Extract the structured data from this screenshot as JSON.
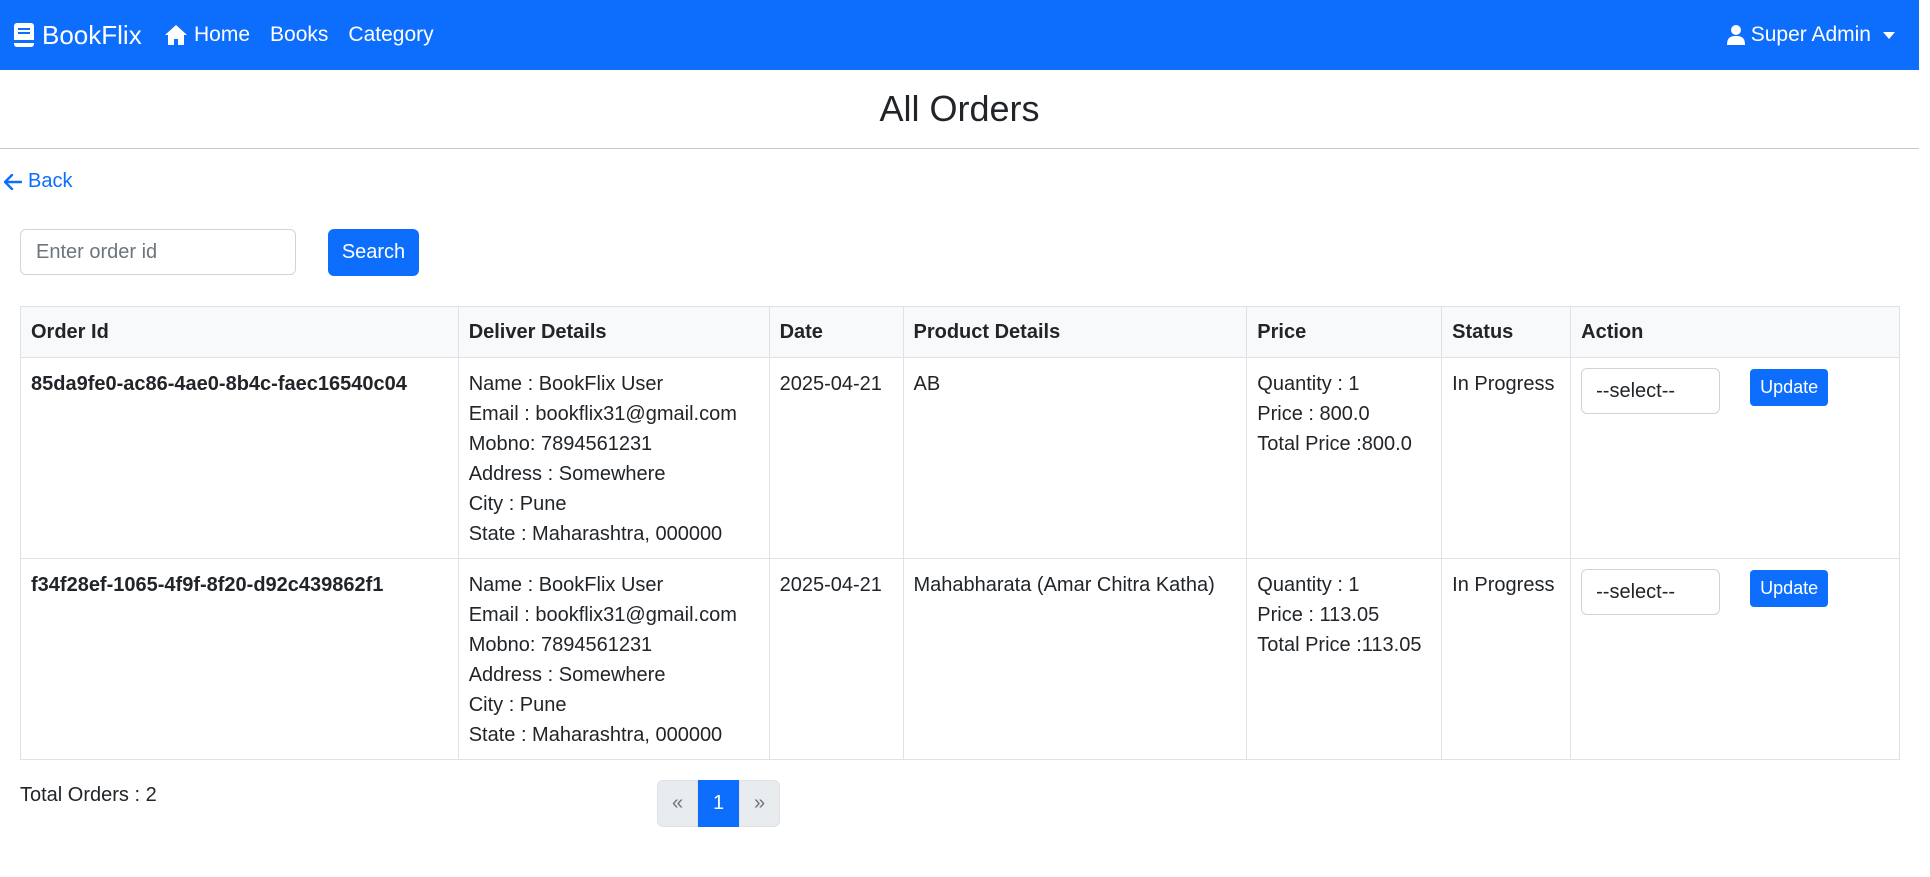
{
  "navbar": {
    "brand": "BookFlix",
    "links": [
      {
        "label": "Home",
        "icon": "home-icon"
      },
      {
        "label": "Books"
      },
      {
        "label": "Category"
      }
    ],
    "user_label": "Super Admin",
    "background": "#0d6efd"
  },
  "page": {
    "title": "All Orders",
    "back_label": "Back"
  },
  "search": {
    "placeholder": "Enter order id",
    "value": "",
    "button_label": "Search"
  },
  "table": {
    "headers": [
      "Order Id",
      "Deliver Details",
      "Date",
      "Product Details",
      "Price",
      "Status",
      "Action"
    ],
    "rows": [
      {
        "order_id": "85da9fe0-ac86-4ae0-8b4c-faec16540c04",
        "deliver": {
          "name": "Name : BookFlix User",
          "email": "Email : bookflix31@gmail.com",
          "mobno": "Mobno: 7894561231",
          "address": "Address : Somewhere",
          "city": "City : Pune",
          "state": "State : Maharashtra, 000000"
        },
        "date": "2025-04-21",
        "product": "AB",
        "price": {
          "quantity": "Quantity : 1",
          "price": "Price : 800.0",
          "total": "Total Price :800.0"
        },
        "status": "In Progress",
        "select_value": "--select--",
        "update_label": "Update"
      },
      {
        "order_id": "f34f28ef-1065-4f9f-8f20-d92c439862f1",
        "deliver": {
          "name": "Name : BookFlix User",
          "email": "Email : bookflix31@gmail.com",
          "mobno": "Mobno: 7894561231",
          "address": "Address : Somewhere",
          "city": "City : Pune",
          "state": "State : Maharashtra, 000000"
        },
        "date": "2025-04-21",
        "product": "Mahabharata (Amar Chitra Katha)",
        "price": {
          "quantity": "Quantity : 1",
          "price": "Price : 113.05",
          "total": "Total Price :113.05"
        },
        "status": "In Progress",
        "select_value": "--select--",
        "update_label": "Update"
      }
    ]
  },
  "footer": {
    "total_orders": "Total Orders : 2"
  },
  "pagination": {
    "prev": "«",
    "current": "1",
    "next": "»"
  }
}
